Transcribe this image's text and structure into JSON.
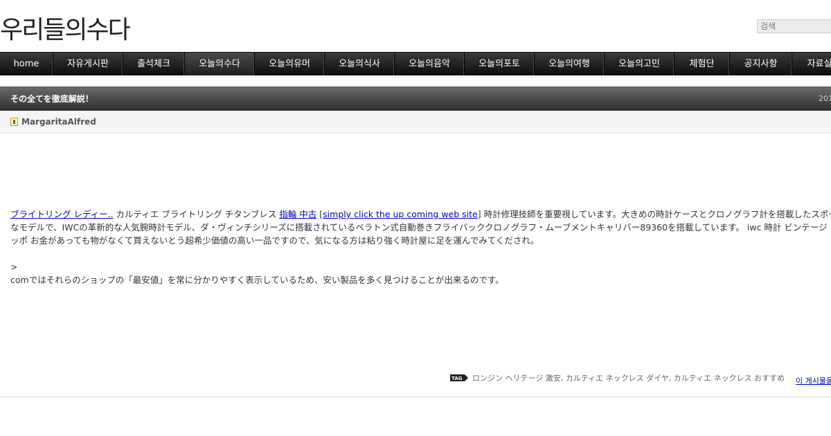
{
  "site": {
    "title": "우리들의수다"
  },
  "search": {
    "placeholder": "검색"
  },
  "nav": {
    "items": [
      {
        "label": "home"
      },
      {
        "label": "자유게시판"
      },
      {
        "label": "출석체크"
      },
      {
        "label": "오늘의수다"
      },
      {
        "label": "오늘의유머"
      },
      {
        "label": "오늘의식사"
      },
      {
        "label": "오늘의음악"
      },
      {
        "label": "오늘의포토"
      },
      {
        "label": "오늘의여행"
      },
      {
        "label": "오늘의고민"
      },
      {
        "label": "체험단"
      },
      {
        "label": "공지사항"
      },
      {
        "label": "자료실"
      }
    ],
    "active_label": "오늘의수다"
  },
  "post": {
    "title": "その全てを徹底解説！",
    "date": "201",
    "author": "MargaritaAlfred",
    "body": {
      "link1": "ブライトリング レディー..",
      "text1": " カルティエ ブライトリング チタンブレス ",
      "link2": "指輪 中古",
      "bracket_open": " [",
      "link3": "simply click the up coming web site",
      "bracket_close_text": "] 時計修理技師を重要視しています。大きめの時計ケースとクロノグラフ計を搭載したスポーツ",
      "line2": "なモデルで、IWCの革新的な人気腕時計モデル、ダ・ヴィンチシリーズに搭載されているペラトン式自動巻きフライバッククロノグラフ・ムーブメントキャリバー89360を搭載しています。 iwc 時計 ビンテージ",
      "line3": "ッポ お金があっても物がなくて買えないとう超希少価値の高い一品ですので、気になる方は粘り強く時計屋に足を運んでみてくだされ。",
      "line4": ">",
      "line5": "comではそれらのショップの「最安値」を常に分かりやすく表示しているため、安い製品を多く見つけることが出来るのです。"
    },
    "tag_label": "TAG",
    "tags": "ロンジン ヘリテージ 激安, カルティエ ネックレス ダイヤ, カルティエ ネックレス おすすめ",
    "more_link": "이 게시물을"
  }
}
